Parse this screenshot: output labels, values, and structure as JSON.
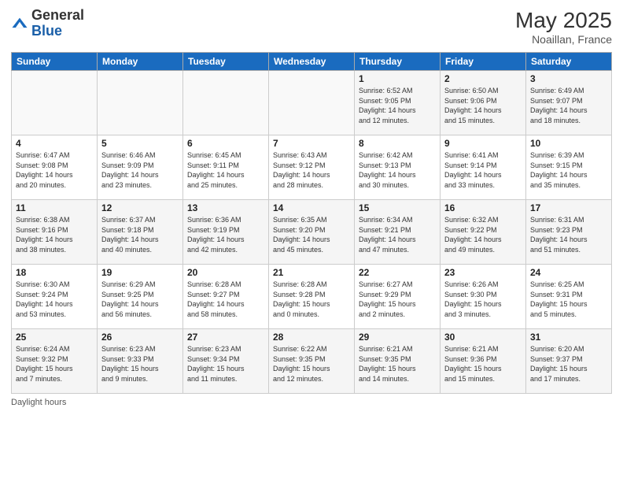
{
  "header": {
    "logo_general": "General",
    "logo_blue": "Blue",
    "month_year": "May 2025",
    "location": "Noaillan, France"
  },
  "days_of_week": [
    "Sunday",
    "Monday",
    "Tuesday",
    "Wednesday",
    "Thursday",
    "Friday",
    "Saturday"
  ],
  "weeks": [
    [
      {
        "day": "",
        "info": ""
      },
      {
        "day": "",
        "info": ""
      },
      {
        "day": "",
        "info": ""
      },
      {
        "day": "",
        "info": ""
      },
      {
        "day": "1",
        "info": "Sunrise: 6:52 AM\nSunset: 9:05 PM\nDaylight: 14 hours\nand 12 minutes."
      },
      {
        "day": "2",
        "info": "Sunrise: 6:50 AM\nSunset: 9:06 PM\nDaylight: 14 hours\nand 15 minutes."
      },
      {
        "day": "3",
        "info": "Sunrise: 6:49 AM\nSunset: 9:07 PM\nDaylight: 14 hours\nand 18 minutes."
      }
    ],
    [
      {
        "day": "4",
        "info": "Sunrise: 6:47 AM\nSunset: 9:08 PM\nDaylight: 14 hours\nand 20 minutes."
      },
      {
        "day": "5",
        "info": "Sunrise: 6:46 AM\nSunset: 9:09 PM\nDaylight: 14 hours\nand 23 minutes."
      },
      {
        "day": "6",
        "info": "Sunrise: 6:45 AM\nSunset: 9:11 PM\nDaylight: 14 hours\nand 25 minutes."
      },
      {
        "day": "7",
        "info": "Sunrise: 6:43 AM\nSunset: 9:12 PM\nDaylight: 14 hours\nand 28 minutes."
      },
      {
        "day": "8",
        "info": "Sunrise: 6:42 AM\nSunset: 9:13 PM\nDaylight: 14 hours\nand 30 minutes."
      },
      {
        "day": "9",
        "info": "Sunrise: 6:41 AM\nSunset: 9:14 PM\nDaylight: 14 hours\nand 33 minutes."
      },
      {
        "day": "10",
        "info": "Sunrise: 6:39 AM\nSunset: 9:15 PM\nDaylight: 14 hours\nand 35 minutes."
      }
    ],
    [
      {
        "day": "11",
        "info": "Sunrise: 6:38 AM\nSunset: 9:16 PM\nDaylight: 14 hours\nand 38 minutes."
      },
      {
        "day": "12",
        "info": "Sunrise: 6:37 AM\nSunset: 9:18 PM\nDaylight: 14 hours\nand 40 minutes."
      },
      {
        "day": "13",
        "info": "Sunrise: 6:36 AM\nSunset: 9:19 PM\nDaylight: 14 hours\nand 42 minutes."
      },
      {
        "day": "14",
        "info": "Sunrise: 6:35 AM\nSunset: 9:20 PM\nDaylight: 14 hours\nand 45 minutes."
      },
      {
        "day": "15",
        "info": "Sunrise: 6:34 AM\nSunset: 9:21 PM\nDaylight: 14 hours\nand 47 minutes."
      },
      {
        "day": "16",
        "info": "Sunrise: 6:32 AM\nSunset: 9:22 PM\nDaylight: 14 hours\nand 49 minutes."
      },
      {
        "day": "17",
        "info": "Sunrise: 6:31 AM\nSunset: 9:23 PM\nDaylight: 14 hours\nand 51 minutes."
      }
    ],
    [
      {
        "day": "18",
        "info": "Sunrise: 6:30 AM\nSunset: 9:24 PM\nDaylight: 14 hours\nand 53 minutes."
      },
      {
        "day": "19",
        "info": "Sunrise: 6:29 AM\nSunset: 9:25 PM\nDaylight: 14 hours\nand 56 minutes."
      },
      {
        "day": "20",
        "info": "Sunrise: 6:28 AM\nSunset: 9:27 PM\nDaylight: 14 hours\nand 58 minutes."
      },
      {
        "day": "21",
        "info": "Sunrise: 6:28 AM\nSunset: 9:28 PM\nDaylight: 15 hours\nand 0 minutes."
      },
      {
        "day": "22",
        "info": "Sunrise: 6:27 AM\nSunset: 9:29 PM\nDaylight: 15 hours\nand 2 minutes."
      },
      {
        "day": "23",
        "info": "Sunrise: 6:26 AM\nSunset: 9:30 PM\nDaylight: 15 hours\nand 3 minutes."
      },
      {
        "day": "24",
        "info": "Sunrise: 6:25 AM\nSunset: 9:31 PM\nDaylight: 15 hours\nand 5 minutes."
      }
    ],
    [
      {
        "day": "25",
        "info": "Sunrise: 6:24 AM\nSunset: 9:32 PM\nDaylight: 15 hours\nand 7 minutes."
      },
      {
        "day": "26",
        "info": "Sunrise: 6:23 AM\nSunset: 9:33 PM\nDaylight: 15 hours\nand 9 minutes."
      },
      {
        "day": "27",
        "info": "Sunrise: 6:23 AM\nSunset: 9:34 PM\nDaylight: 15 hours\nand 11 minutes."
      },
      {
        "day": "28",
        "info": "Sunrise: 6:22 AM\nSunset: 9:35 PM\nDaylight: 15 hours\nand 12 minutes."
      },
      {
        "day": "29",
        "info": "Sunrise: 6:21 AM\nSunset: 9:35 PM\nDaylight: 15 hours\nand 14 minutes."
      },
      {
        "day": "30",
        "info": "Sunrise: 6:21 AM\nSunset: 9:36 PM\nDaylight: 15 hours\nand 15 minutes."
      },
      {
        "day": "31",
        "info": "Sunrise: 6:20 AM\nSunset: 9:37 PM\nDaylight: 15 hours\nand 17 minutes."
      }
    ]
  ],
  "footer": {
    "daylight_label": "Daylight hours"
  }
}
